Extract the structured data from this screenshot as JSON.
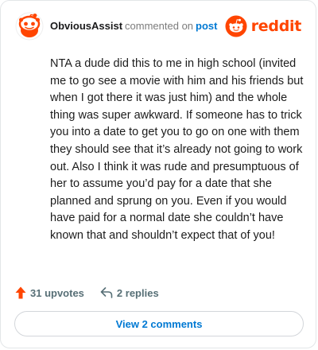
{
  "comment": {
    "username": "ObviousAssist",
    "action_text": "commented on",
    "target_text": "post",
    "body": "NTA a dude did this to me in high school (invited me to go see a movie with him and his friends but when I got there it was just him) and the whole thing was super awkward. If someone has to trick you into a date to get you to go on one with them they should see that it’s already not going to work out. Also I think it was rude and presumptuous of her to assume you’d pay for a date that she planned and sprung on you. Even if you would have paid for a normal date she couldn’t have known that and shouldn’t expect that of you!"
  },
  "brand": {
    "name": "reddit",
    "icon": "reddit-logo-icon",
    "color": "#ff4500"
  },
  "actions": {
    "upvotes_label": "31 upvotes",
    "upvote_icon": "upvote-arrow-icon",
    "replies_label": "2 replies",
    "reply_icon": "reply-arrow-icon"
  },
  "view_comments_label": "View 2 comments",
  "colors": {
    "accent": "#ff4500",
    "link": "#0079d3",
    "muted": "#576f76"
  }
}
